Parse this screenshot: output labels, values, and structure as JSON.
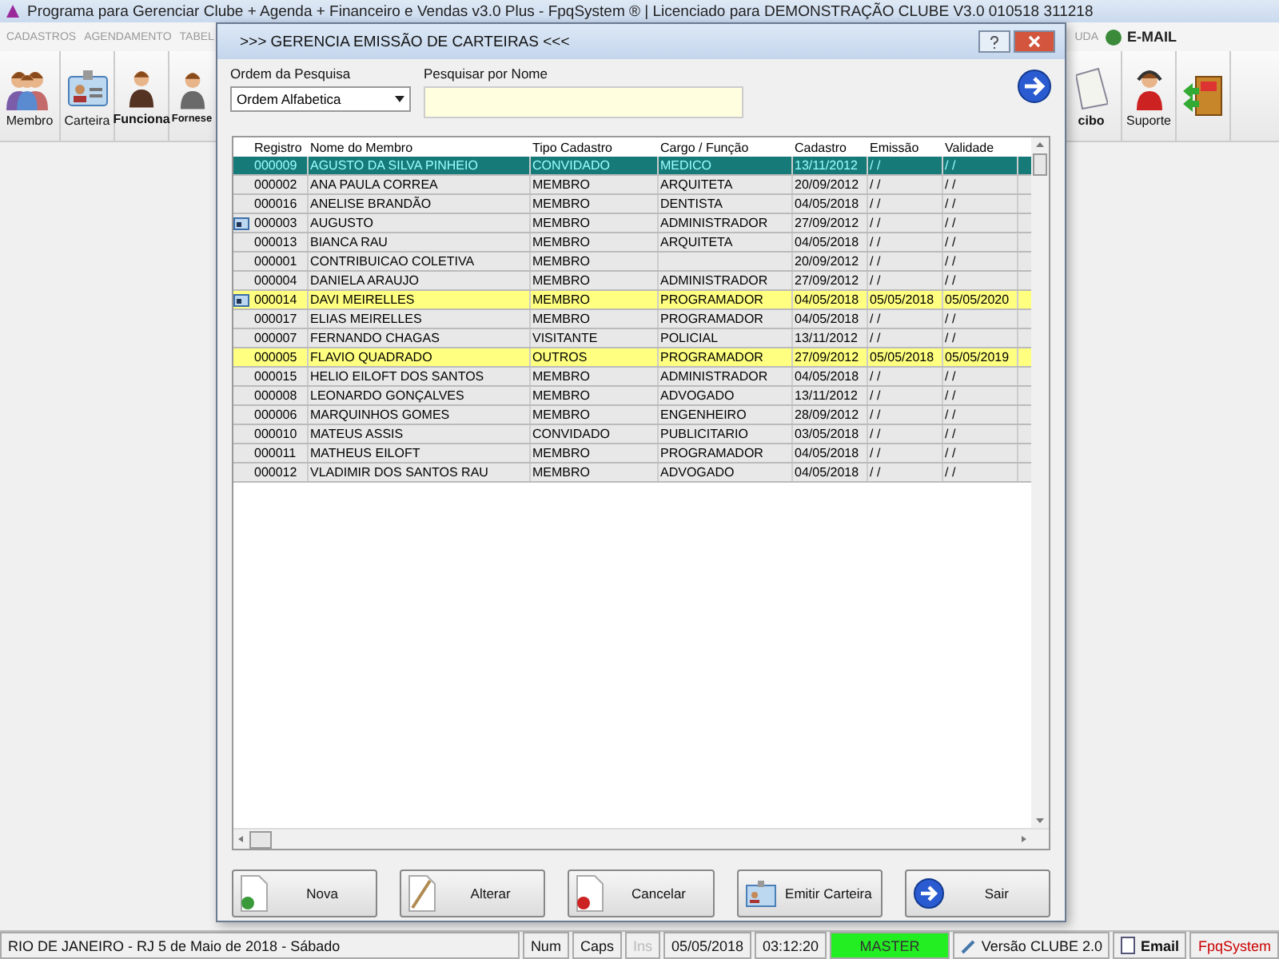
{
  "app_window": {
    "title": "Programa para Gerenciar Clube + Agenda + Financeiro e Vendas v3.0 Plus - FpqSystem ® | Licenciado para  DEMONSTRAÇÃO CLUBE V3.0 010518 311218"
  },
  "menu": [
    {
      "label": "CADASTROS"
    },
    {
      "label": "AGENDAMENTO"
    },
    {
      "label": "TABEL"
    }
  ],
  "menu_right": [
    {
      "label": "UDA",
      "kind": "plain"
    },
    {
      "label": "E-MAIL",
      "kind": "email"
    }
  ],
  "toolbar_left": [
    {
      "label": "Membro",
      "kind": "group"
    },
    {
      "label": "Carteira",
      "kind": "card"
    },
    {
      "label": "Funciona",
      "kind": "woman"
    },
    {
      "label": "Fornese",
      "kind": "man"
    }
  ],
  "toolbar_right": [
    {
      "label": "cibo",
      "kind": "receipt"
    },
    {
      "label": "Suporte",
      "kind": "support"
    },
    {
      "kind": "exit"
    }
  ],
  "dialog": {
    "title": ">>> GERENCIA EMISSÃO DE CARTEIRAS <<<",
    "order": {
      "label": "Ordem da Pesquisa",
      "value": "Ordem Alfabetica"
    },
    "search": {
      "label": "Pesquisar por Nome"
    },
    "table": {
      "columns": [
        "Registro",
        "Nome do Membro",
        "Tipo Cadastro",
        "Cargo / Função",
        "Cadastro",
        "Emissão",
        "Validade"
      ],
      "rows": [
        {
          "cells": [
            "000009",
            "AGUSTO DA SILVA PINHEIO",
            "CONVIDADO",
            "MEDICO",
            "13/11/2012",
            "/ /",
            "/ /"
          ],
          "selected": true,
          "highlighted": false,
          "card": false
        },
        {
          "cells": [
            "000002",
            "ANA PAULA CORREA",
            "MEMBRO",
            "ARQUITETA",
            "20/09/2012",
            "/ /",
            "/ /"
          ],
          "selected": false,
          "highlighted": false,
          "card": false
        },
        {
          "cells": [
            "000016",
            "ANELISE BRANDÃO",
            "MEMBRO",
            "DENTISTA",
            "04/05/2018",
            "/ /",
            "/ /"
          ],
          "selected": false,
          "highlighted": false,
          "card": false
        },
        {
          "cells": [
            "000003",
            "AUGUSTO",
            "MEMBRO",
            "ADMINISTRADOR",
            "27/09/2012",
            "/ /",
            "/ /"
          ],
          "selected": false,
          "highlighted": false,
          "card": true
        },
        {
          "cells": [
            "000013",
            "BIANCA RAU",
            "MEMBRO",
            "ARQUITETA",
            "04/05/2018",
            "/ /",
            "/ /"
          ],
          "selected": false,
          "highlighted": false,
          "card": false
        },
        {
          "cells": [
            "000001",
            "CONTRIBUICAO COLETIVA",
            "MEMBRO",
            "",
            "20/09/2012",
            "/ /",
            "/ /"
          ],
          "selected": false,
          "highlighted": false,
          "card": false
        },
        {
          "cells": [
            "000004",
            "DANIELA ARAUJO",
            "MEMBRO",
            "ADMINISTRADOR",
            "27/09/2012",
            "/ /",
            "/ /"
          ],
          "selected": false,
          "highlighted": false,
          "card": false
        },
        {
          "cells": [
            "000014",
            "DAVI MEIRELLES",
            "MEMBRO",
            "PROGRAMADOR",
            "04/05/2018",
            "05/05/2018",
            "05/05/2020"
          ],
          "selected": false,
          "highlighted": true,
          "card": true
        },
        {
          "cells": [
            "000017",
            "ELIAS MEIRELLES",
            "MEMBRO",
            "PROGRAMADOR",
            "04/05/2018",
            "/ /",
            "/ /"
          ],
          "selected": false,
          "highlighted": false,
          "card": false
        },
        {
          "cells": [
            "000007",
            "FERNANDO CHAGAS",
            "VISITANTE",
            "POLICIAL",
            "13/11/2012",
            "/ /",
            "/ /"
          ],
          "selected": false,
          "highlighted": false,
          "card": false
        },
        {
          "cells": [
            "000005",
            "FLAVIO QUADRADO",
            "OUTROS",
            "PROGRAMADOR",
            "27/09/2012",
            "05/05/2018",
            "05/05/2019"
          ],
          "selected": false,
          "highlighted": true,
          "card": false
        },
        {
          "cells": [
            "000015",
            "HELIO EILOFT DOS SANTOS",
            "MEMBRO",
            "ADMINISTRADOR",
            "04/05/2018",
            "/ /",
            "/ /"
          ],
          "selected": false,
          "highlighted": false,
          "card": false
        },
        {
          "cells": [
            "000008",
            "LEONARDO GONÇALVES",
            "MEMBRO",
            "ADVOGADO",
            "13/11/2012",
            "/ /",
            "/ /"
          ],
          "selected": false,
          "highlighted": false,
          "card": false
        },
        {
          "cells": [
            "000006",
            "MARQUINHOS GOMES",
            "MEMBRO",
            "ENGENHEIRO",
            "28/09/2012",
            "/ /",
            "/ /"
          ],
          "selected": false,
          "highlighted": false,
          "card": false
        },
        {
          "cells": [
            "000010",
            "MATEUS ASSIS",
            "CONVIDADO",
            "PUBLICITARIO",
            "03/05/2018",
            "/ /",
            "/ /"
          ],
          "selected": false,
          "highlighted": false,
          "card": false
        },
        {
          "cells": [
            "000011",
            "MATHEUS EILOFT",
            "MEMBRO",
            "PROGRAMADOR",
            "04/05/2018",
            "/ /",
            "/ /"
          ],
          "selected": false,
          "highlighted": false,
          "card": false
        },
        {
          "cells": [
            "000012",
            "VLADIMIR DOS SANTOS RAU",
            "MEMBRO",
            "ADVOGADO",
            "04/05/2018",
            "/ /",
            "/ /"
          ],
          "selected": false,
          "highlighted": false,
          "card": false
        }
      ]
    },
    "buttons": [
      {
        "label": "Nova",
        "kind": "new"
      },
      {
        "label": "Alterar",
        "kind": "edit"
      },
      {
        "label": "Cancelar",
        "kind": "cancel"
      },
      {
        "label": "Emitir Carteira",
        "kind": "card"
      },
      {
        "label": "Sair",
        "kind": "exit"
      }
    ]
  },
  "status_bar": [
    {
      "text": "RIO DE JANEIRO - RJ  5 de Maio de 2018 - Sábado",
      "kind": "location",
      "disabled": false
    },
    {
      "text": "Num",
      "kind": "key",
      "disabled": false
    },
    {
      "text": "Caps",
      "kind": "key",
      "disabled": false
    },
    {
      "text": "Ins",
      "kind": "key",
      "disabled": true
    },
    {
      "text": "05/05/2018",
      "kind": "key",
      "disabled": false
    },
    {
      "text": "03:12:20",
      "kind": "key",
      "disabled": false
    },
    {
      "text": "MASTER",
      "kind": "user",
      "disabled": false
    },
    {
      "text": "Versão CLUBE 2.0",
      "kind": "version",
      "disabled": false
    },
    {
      "text": "Email",
      "kind": "email",
      "disabled": false
    },
    {
      "text": "FpqSystem",
      "kind": "brand",
      "disabled": false
    }
  ]
}
